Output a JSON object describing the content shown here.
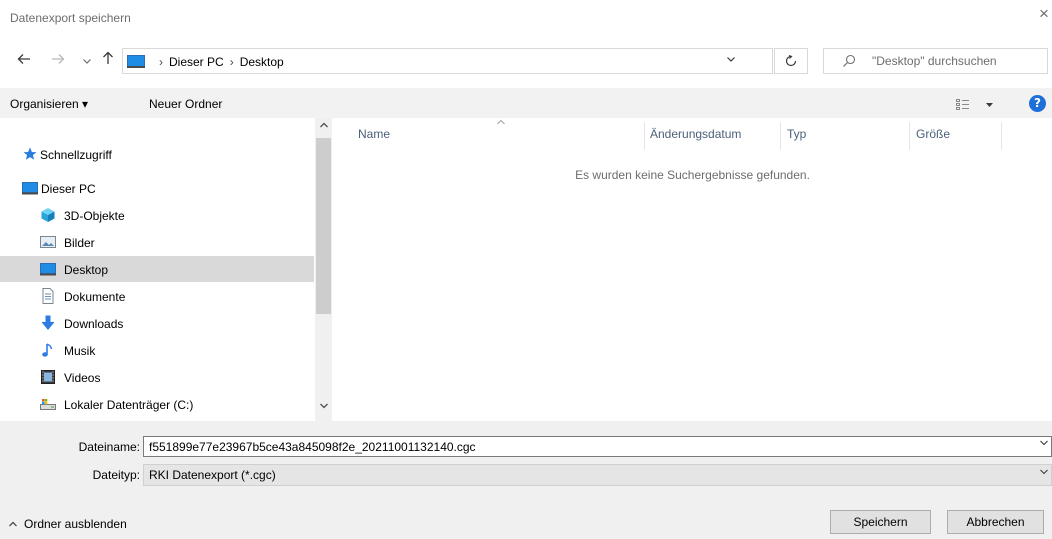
{
  "window": {
    "title": "Datenexport speichern",
    "close_glyph": "×"
  },
  "nav": {
    "back_icon": "arrow-left-icon",
    "forward_icon": "arrow-right-icon",
    "recent_icon": "chevron-down-icon",
    "up_icon": "arrow-up-icon"
  },
  "address": {
    "crumbs": [
      "Dieser PC",
      "Desktop"
    ],
    "separator": "›"
  },
  "search": {
    "placeholder": "\"Desktop\" durchsuchen"
  },
  "commandbar": {
    "organize": "Organisieren ▾",
    "new_folder": "Neuer Ordner",
    "help": "?"
  },
  "navpane": {
    "items": [
      {
        "label": "Schnellzugriff",
        "icon": "star-icon"
      },
      {
        "label": "Dieser PC",
        "icon": "computer-icon"
      },
      {
        "label": "3D-Objekte",
        "icon": "cube-icon"
      },
      {
        "label": "Bilder",
        "icon": "pictures-icon"
      },
      {
        "label": "Desktop",
        "icon": "desktop-icon",
        "selected": true
      },
      {
        "label": "Dokumente",
        "icon": "document-icon"
      },
      {
        "label": "Downloads",
        "icon": "download-icon"
      },
      {
        "label": "Musik",
        "icon": "music-icon"
      },
      {
        "label": "Videos",
        "icon": "video-icon"
      },
      {
        "label": "Lokaler Datenträger (C:)",
        "icon": "drive-icon"
      }
    ]
  },
  "filelist": {
    "columns": [
      "Name",
      "Änderungsdatum",
      "Typ",
      "Größe"
    ],
    "empty_message": "Es wurden keine Suchergebnisse gefunden."
  },
  "form": {
    "filename_label": "Dateiname:",
    "filename_value": "f551899e77e23967b5ce43a845098f2e_20211001132140.cgc",
    "filetype_label": "Dateityp:",
    "filetype_value": "RKI Datenexport (*.cgc)",
    "toggle_label": "Ordner ausblenden",
    "save_label": "Speichern",
    "cancel_label": "Abbrechen"
  },
  "colors": {
    "accent": "#1e6fd9",
    "selected_bg": "#d9d9d9",
    "commandbar_bg": "#f2f2f2",
    "bottom_bg": "#f0f0f0"
  }
}
